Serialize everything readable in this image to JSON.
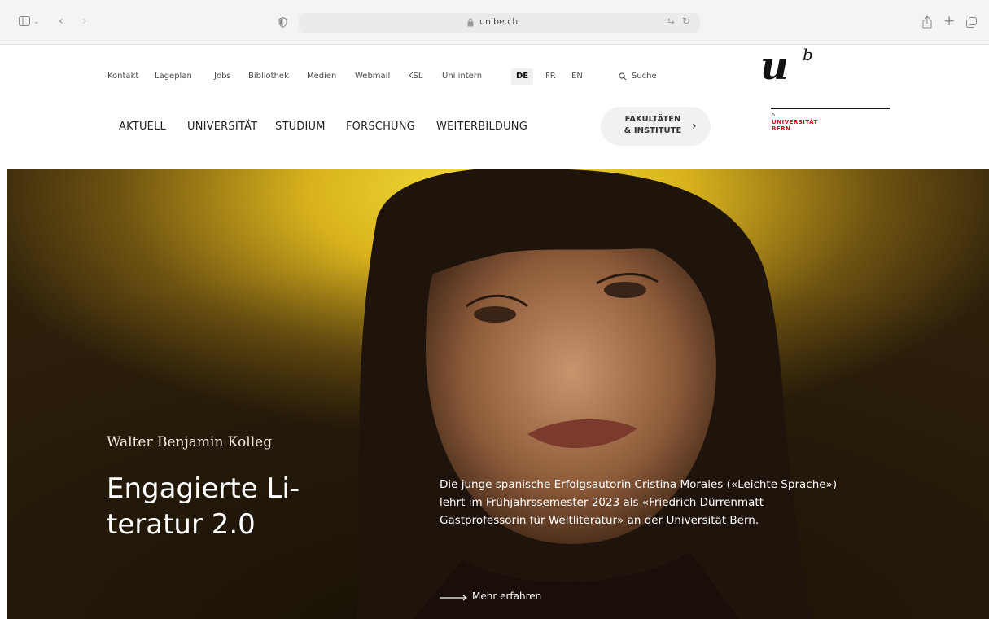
{
  "browser": {
    "url": "unibe.ch"
  },
  "header": {
    "utility_links": [
      "Kontakt",
      "Lageplan",
      "Jobs",
      "Bibliothek",
      "Medien",
      "Webmail",
      "KSL",
      "Uni intern"
    ],
    "languages": [
      "DE",
      "FR",
      "EN"
    ],
    "active_language": "DE",
    "search_label": "Suche",
    "main_nav": [
      "AKTUELL",
      "UNIVERSITÄT",
      "STUDIUM",
      "FORSCHUNG",
      "WEITERBILDUNG"
    ],
    "faculties_button": "FAKULTÄTEN\n& INSTITUTE",
    "logo": {
      "mark": "u",
      "superscript": "b",
      "name_line1": "UNIVERSITÄT",
      "name_line2": "BERN",
      "accent_color": "#e2001a"
    }
  },
  "hero": {
    "kicker": "Walter Benjamin Kolleg",
    "title": "Engagierte Li-\nteratur 2.0",
    "description": "Die junge spanische Erfolgsautorin Cristina Morales («Leichte Sprache») lehrt im Frühjahrssemester 2023 als «Friedrich Dürrenmatt Gastprofessorin für Weltliteratur» an der Universität Bern.",
    "cta": "Mehr erfahren"
  }
}
